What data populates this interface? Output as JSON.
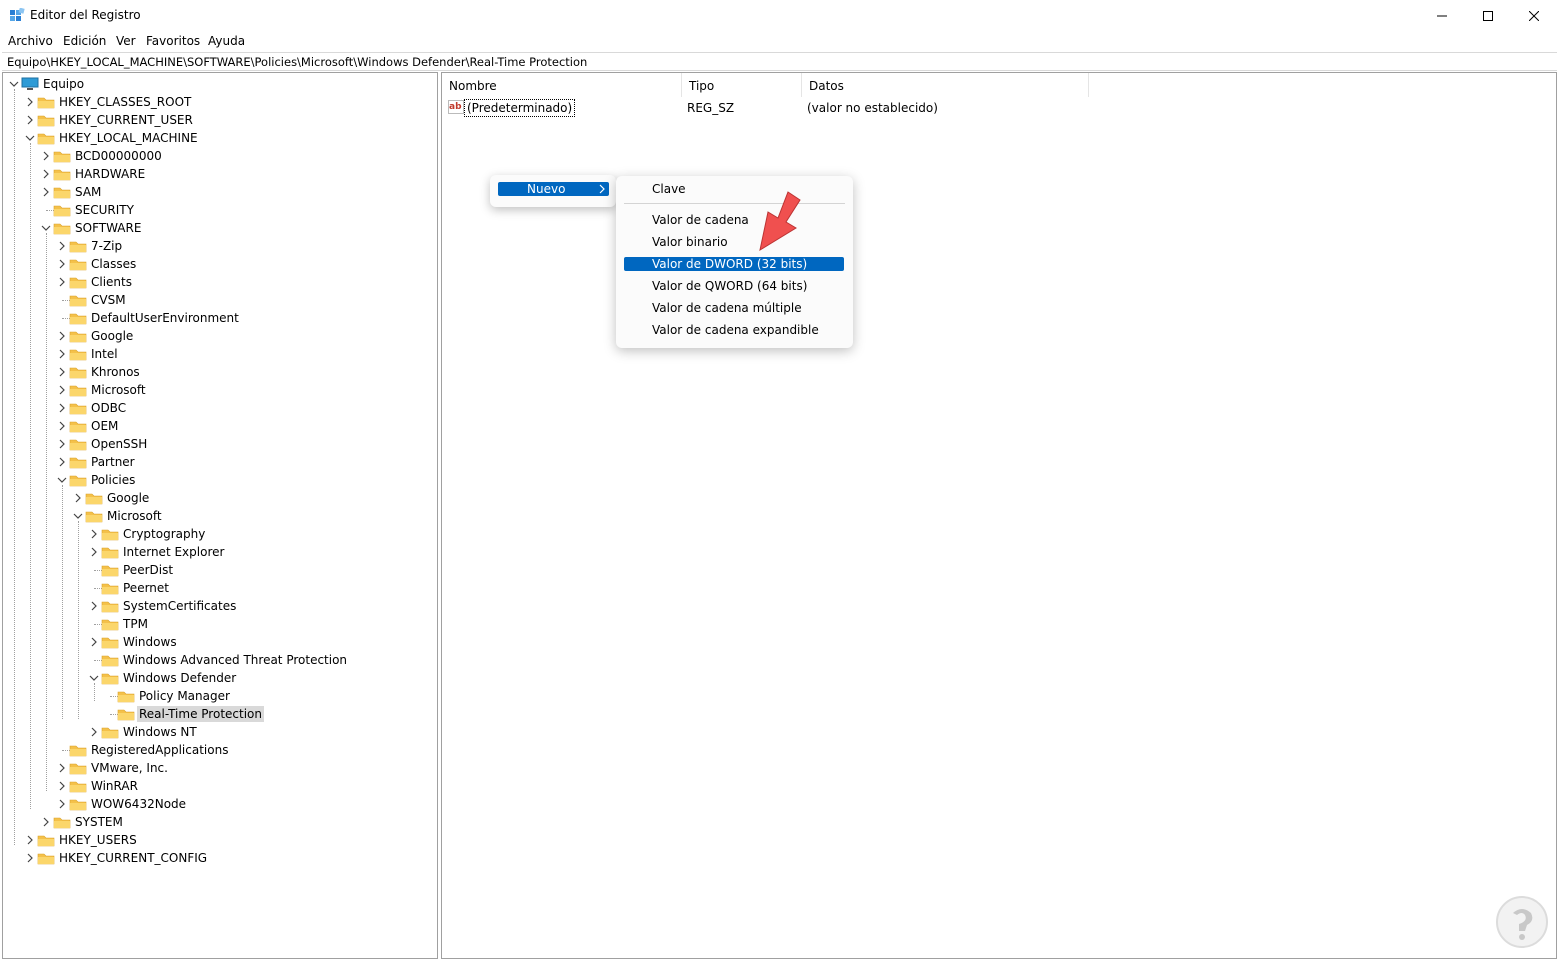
{
  "window": {
    "title": "Editor del Registro",
    "icon": "registry-editor-icon"
  },
  "menu": [
    "Archivo",
    "Edición",
    "Ver",
    "Favoritos",
    "Ayuda"
  ],
  "address": "Equipo\\HKEY_LOCAL_MACHINE\\SOFTWARE\\Policies\\Microsoft\\Windows Defender\\Real-Time Protection",
  "tree": {
    "root": "Equipo",
    "items": [
      {
        "label": "HKEY_CLASSES_ROOT"
      },
      {
        "label": "HKEY_CURRENT_USER"
      },
      {
        "label": "HKEY_LOCAL_MACHINE"
      },
      {
        "label": "BCD00000000"
      },
      {
        "label": "HARDWARE"
      },
      {
        "label": "SAM"
      },
      {
        "label": "SECURITY"
      },
      {
        "label": "SOFTWARE"
      },
      {
        "label": "7-Zip"
      },
      {
        "label": "Classes"
      },
      {
        "label": "Clients"
      },
      {
        "label": "CVSM"
      },
      {
        "label": "DefaultUserEnvironment"
      },
      {
        "label": "Google"
      },
      {
        "label": "Intel"
      },
      {
        "label": "Khronos"
      },
      {
        "label": "Microsoft"
      },
      {
        "label": "ODBC"
      },
      {
        "label": "OEM"
      },
      {
        "label": "OpenSSH"
      },
      {
        "label": "Partner"
      },
      {
        "label": "Policies"
      },
      {
        "label": "Google"
      },
      {
        "label": "Microsoft"
      },
      {
        "label": "Cryptography"
      },
      {
        "label": "Internet Explorer"
      },
      {
        "label": "PeerDist"
      },
      {
        "label": "Peernet"
      },
      {
        "label": "SystemCertificates"
      },
      {
        "label": "TPM"
      },
      {
        "label": "Windows"
      },
      {
        "label": "Windows Advanced Threat Protection"
      },
      {
        "label": "Windows Defender"
      },
      {
        "label": "Policy Manager"
      },
      {
        "label": "Real-Time Protection"
      },
      {
        "label": "Windows NT"
      },
      {
        "label": "RegisteredApplications"
      },
      {
        "label": "VMware, Inc."
      },
      {
        "label": "WinRAR"
      },
      {
        "label": "WOW6432Node"
      },
      {
        "label": "SYSTEM"
      },
      {
        "label": "HKEY_USERS"
      },
      {
        "label": "HKEY_CURRENT_CONFIG"
      }
    ]
  },
  "list": {
    "columns": [
      "Nombre",
      "Tipo",
      "Datos"
    ],
    "rows": [
      {
        "name": "(Predeterminado)",
        "type": "REG_SZ",
        "data": "(valor no establecido)"
      }
    ]
  },
  "context_menu": {
    "new_label": "Nuevo",
    "submenu": [
      "Clave",
      "Valor de cadena",
      "Valor binario",
      "Valor de DWORD (32 bits)",
      "Valor de QWORD (64 bits)",
      "Valor de cadena múltiple",
      "Valor de cadena expandible"
    ],
    "highlighted": "Valor de DWORD (32 bits)"
  },
  "colors": {
    "highlight": "#0067c0",
    "folder": "#f4c14a",
    "arrow": "#f0504f"
  }
}
